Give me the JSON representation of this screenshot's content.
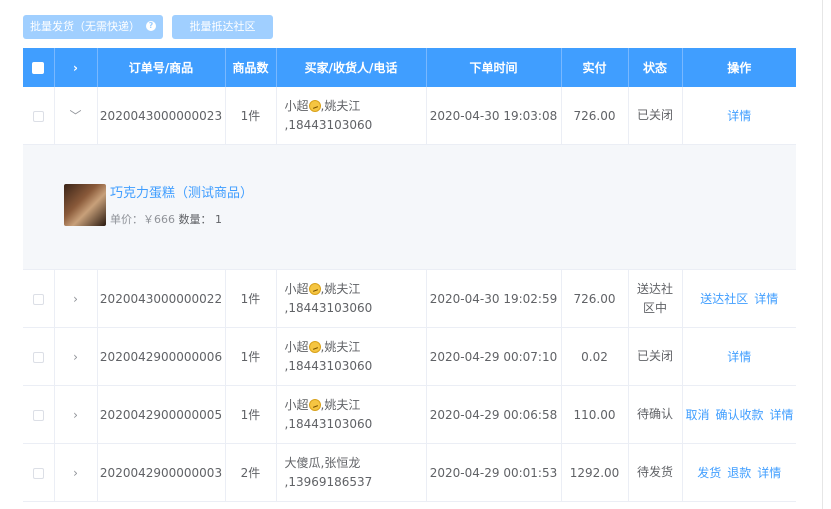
{
  "toolbar": {
    "batch_ship_label": "批量发货（无需快递）",
    "batch_ship_help": "?",
    "batch_community_label": "批量抵达社区"
  },
  "table": {
    "headers": {
      "expand": "›",
      "order_product": "订单号/商品",
      "qty": "商品数",
      "buyer": "买家/收货人/电话",
      "time": "下单时间",
      "paid": "实付",
      "status": "状态",
      "ops": "操作"
    },
    "rows": [
      {
        "order_no": "2020043000000023",
        "qty": "1件",
        "buyer_name": "小超",
        "buyer_rest": ",姚夫江",
        "phone": ",18443103060",
        "time": "2020-04-30 19:03:08",
        "paid": "726.00",
        "status": "已关闭",
        "ops": [
          "详情"
        ],
        "expanded": true,
        "product": {
          "name": "巧克力蛋糕（测试商品）",
          "price_label": "单价：",
          "price": "￥666",
          "qty_label": "数量：",
          "qty": "1"
        }
      },
      {
        "order_no": "2020043000000022",
        "qty": "1件",
        "buyer_name": "小超",
        "buyer_rest": ",姚夫江",
        "phone": ",18443103060",
        "time": "2020-04-30 19:02:59",
        "paid": "726.00",
        "status": "送达社区中",
        "ops": [
          "送达社区",
          "详情"
        ]
      },
      {
        "order_no": "2020042900000006",
        "qty": "1件",
        "buyer_name": "小超",
        "buyer_rest": ",姚夫江",
        "phone": ",18443103060",
        "time": "2020-04-29 00:07:10",
        "paid": "0.02",
        "status": "已关闭",
        "ops": [
          "详情"
        ]
      },
      {
        "order_no": "2020042900000005",
        "qty": "1件",
        "buyer_name": "小超",
        "buyer_rest": ",姚夫江",
        "phone": ",18443103060",
        "time": "2020-04-29 00:06:58",
        "paid": "110.00",
        "status": "待确认",
        "ops": [
          "取消",
          "确认收款",
          "详情"
        ]
      },
      {
        "order_no": "2020042900000003",
        "qty": "2件",
        "buyer_name": "大傻瓜",
        "buyer_rest": ",张恒龙",
        "phone": ",13969186537",
        "time": "2020-04-29 00:01:53",
        "paid": "1292.00",
        "status": "待发货",
        "ops": [
          "发货",
          "退款",
          "详情"
        ]
      }
    ]
  }
}
